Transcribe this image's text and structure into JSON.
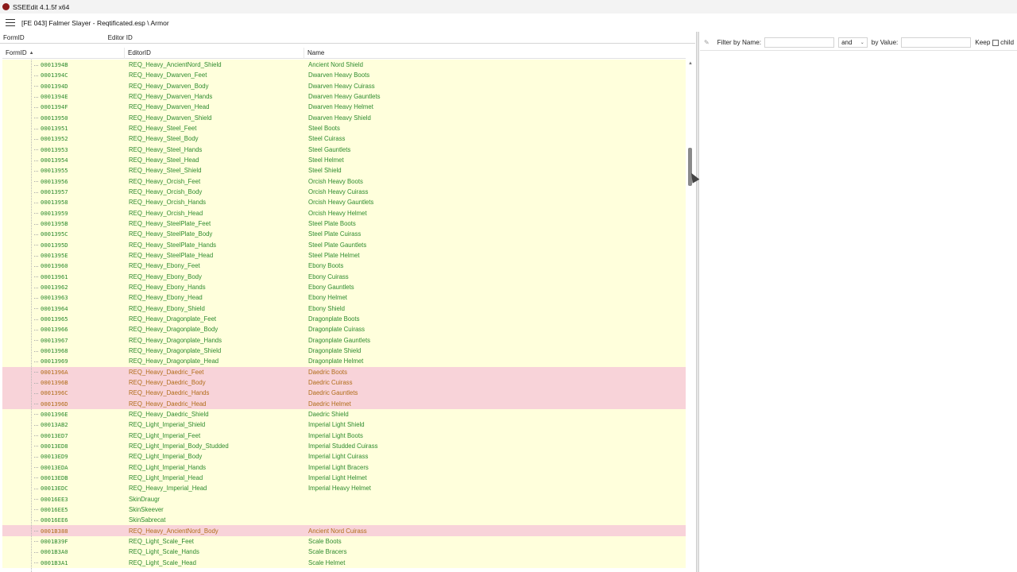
{
  "window": {
    "title": "SSEEdit 4.1.5f x64"
  },
  "path": {
    "text": "[FE 043] Falmer Slayer - Reqtificated.esp \\ Armor"
  },
  "filter": {
    "formid_label": "FormID",
    "editorid_label": "Editor ID"
  },
  "columns": {
    "formid": "FormID",
    "editorid": "EditorID",
    "name": "Name"
  },
  "right_panel": {
    "filter_by_name_label": "Filter by Name:",
    "operator_value": "and",
    "by_value_label": "by Value:",
    "keep_label": "Keep",
    "child_label": "child"
  },
  "colors": {
    "row_yellow": "#ffffdc",
    "row_conflict": "#f8d3d9",
    "text_green": "#2e8b2e",
    "text_orange": "#b06d1a"
  },
  "rows": [
    {
      "formid": "0001394B",
      "editorid": "REQ_Heavy_AncientNord_Shield",
      "name": "Ancient Nord Shield",
      "conflict": false
    },
    {
      "formid": "0001394C",
      "editorid": "REQ_Heavy_Dwarven_Feet",
      "name": "Dwarven Heavy Boots",
      "conflict": false
    },
    {
      "formid": "0001394D",
      "editorid": "REQ_Heavy_Dwarven_Body",
      "name": "Dwarven Heavy Cuirass",
      "conflict": false
    },
    {
      "formid": "0001394E",
      "editorid": "REQ_Heavy_Dwarven_Hands",
      "name": "Dwarven Heavy Gauntlets",
      "conflict": false
    },
    {
      "formid": "0001394F",
      "editorid": "REQ_Heavy_Dwarven_Head",
      "name": "Dwarven Heavy Helmet",
      "conflict": false
    },
    {
      "formid": "00013950",
      "editorid": "REQ_Heavy_Dwarven_Shield",
      "name": "Dwarven Heavy Shield",
      "conflict": false
    },
    {
      "formid": "00013951",
      "editorid": "REQ_Heavy_Steel_Feet",
      "name": "Steel Boots",
      "conflict": false
    },
    {
      "formid": "00013952",
      "editorid": "REQ_Heavy_Steel_Body",
      "name": "Steel Cuirass",
      "conflict": false
    },
    {
      "formid": "00013953",
      "editorid": "REQ_Heavy_Steel_Hands",
      "name": "Steel Gauntlets",
      "conflict": false
    },
    {
      "formid": "00013954",
      "editorid": "REQ_Heavy_Steel_Head",
      "name": "Steel Helmet",
      "conflict": false
    },
    {
      "formid": "00013955",
      "editorid": "REQ_Heavy_Steel_Shield",
      "name": "Steel Shield",
      "conflict": false
    },
    {
      "formid": "00013956",
      "editorid": "REQ_Heavy_Orcish_Feet",
      "name": "Orcish Heavy Boots",
      "conflict": false
    },
    {
      "formid": "00013957",
      "editorid": "REQ_Heavy_Orcish_Body",
      "name": "Orcish Heavy Cuirass",
      "conflict": false
    },
    {
      "formid": "00013958",
      "editorid": "REQ_Heavy_Orcish_Hands",
      "name": "Orcish Heavy Gauntlets",
      "conflict": false
    },
    {
      "formid": "00013959",
      "editorid": "REQ_Heavy_Orcish_Head",
      "name": "Orcish Heavy Helmet",
      "conflict": false
    },
    {
      "formid": "0001395B",
      "editorid": "REQ_Heavy_SteelPlate_Feet",
      "name": "Steel Plate Boots",
      "conflict": false
    },
    {
      "formid": "0001395C",
      "editorid": "REQ_Heavy_SteelPlate_Body",
      "name": "Steel Plate Cuirass",
      "conflict": false
    },
    {
      "formid": "0001395D",
      "editorid": "REQ_Heavy_SteelPlate_Hands",
      "name": "Steel Plate Gauntlets",
      "conflict": false
    },
    {
      "formid": "0001395E",
      "editorid": "REQ_Heavy_SteelPlate_Head",
      "name": "Steel Plate Helmet",
      "conflict": false
    },
    {
      "formid": "00013960",
      "editorid": "REQ_Heavy_Ebony_Feet",
      "name": "Ebony Boots",
      "conflict": false
    },
    {
      "formid": "00013961",
      "editorid": "REQ_Heavy_Ebony_Body",
      "name": "Ebony Cuirass",
      "conflict": false
    },
    {
      "formid": "00013962",
      "editorid": "REQ_Heavy_Ebony_Hands",
      "name": "Ebony Gauntlets",
      "conflict": false
    },
    {
      "formid": "00013963",
      "editorid": "REQ_Heavy_Ebony_Head",
      "name": "Ebony Helmet",
      "conflict": false
    },
    {
      "formid": "00013964",
      "editorid": "REQ_Heavy_Ebony_Shield",
      "name": "Ebony Shield",
      "conflict": false
    },
    {
      "formid": "00013965",
      "editorid": "REQ_Heavy_Dragonplate_Feet",
      "name": "Dragonplate Boots",
      "conflict": false
    },
    {
      "formid": "00013966",
      "editorid": "REQ_Heavy_Dragonplate_Body",
      "name": "Dragonplate Cuirass",
      "conflict": false
    },
    {
      "formid": "00013967",
      "editorid": "REQ_Heavy_Dragonplate_Hands",
      "name": "Dragonplate Gauntlets",
      "conflict": false
    },
    {
      "formid": "00013968",
      "editorid": "REQ_Heavy_Dragonplate_Shield",
      "name": "Dragonplate Shield",
      "conflict": false
    },
    {
      "formid": "00013969",
      "editorid": "REQ_Heavy_Dragonplate_Head",
      "name": "Dragonplate Helmet",
      "conflict": false
    },
    {
      "formid": "0001396A",
      "editorid": "REQ_Heavy_Daedric_Feet",
      "name": "Daedric Boots",
      "conflict": true
    },
    {
      "formid": "0001396B",
      "editorid": "REQ_Heavy_Daedric_Body",
      "name": "Daedric Cuirass",
      "conflict": true
    },
    {
      "formid": "0001396C",
      "editorid": "REQ_Heavy_Daedric_Hands",
      "name": "Daedric Gauntlets",
      "conflict": true
    },
    {
      "formid": "0001396D",
      "editorid": "REQ_Heavy_Daedric_Head",
      "name": "Daedric Helmet",
      "conflict": true
    },
    {
      "formid": "0001396E",
      "editorid": "REQ_Heavy_Daedric_Shield",
      "name": "Daedric Shield",
      "conflict": false
    },
    {
      "formid": "00013AB2",
      "editorid": "REQ_Light_Imperial_Shield",
      "name": "Imperial Light Shield",
      "conflict": false
    },
    {
      "formid": "00013ED7",
      "editorid": "REQ_Light_Imperial_Feet",
      "name": "Imperial Light Boots",
      "conflict": false
    },
    {
      "formid": "00013ED8",
      "editorid": "REQ_Light_Imperial_Body_Studded",
      "name": "Imperial Studded Cuirass",
      "conflict": false
    },
    {
      "formid": "00013ED9",
      "editorid": "REQ_Light_Imperial_Body",
      "name": "Imperial Light Cuirass",
      "conflict": false
    },
    {
      "formid": "00013EDA",
      "editorid": "REQ_Light_Imperial_Hands",
      "name": "Imperial Light Bracers",
      "conflict": false
    },
    {
      "formid": "00013EDB",
      "editorid": "REQ_Light_Imperial_Head",
      "name": "Imperial Light Helmet",
      "conflict": false
    },
    {
      "formid": "00013EDC",
      "editorid": "REQ_Heavy_Imperial_Head",
      "name": "Imperial Heavy Helmet",
      "conflict": false
    },
    {
      "formid": "00016EE3",
      "editorid": "SkinDraugr",
      "name": "",
      "conflict": false
    },
    {
      "formid": "00016EE5",
      "editorid": "SkinSkeever",
      "name": "",
      "conflict": false
    },
    {
      "formid": "00016EE6",
      "editorid": "SkinSabrecat",
      "name": "",
      "conflict": false
    },
    {
      "formid": "0001B388",
      "editorid": "REQ_Heavy_AncientNord_Body",
      "name": "Ancient Nord Cuirass",
      "conflict": true
    },
    {
      "formid": "0001B39F",
      "editorid": "REQ_Light_Scale_Feet",
      "name": "Scale Boots",
      "conflict": false
    },
    {
      "formid": "0001B3A0",
      "editorid": "REQ_Light_Scale_Hands",
      "name": "Scale Bracers",
      "conflict": false
    },
    {
      "formid": "0001B3A1",
      "editorid": "REQ_Light_Scale_Head",
      "name": "Scale Helmet",
      "conflict": false
    }
  ]
}
